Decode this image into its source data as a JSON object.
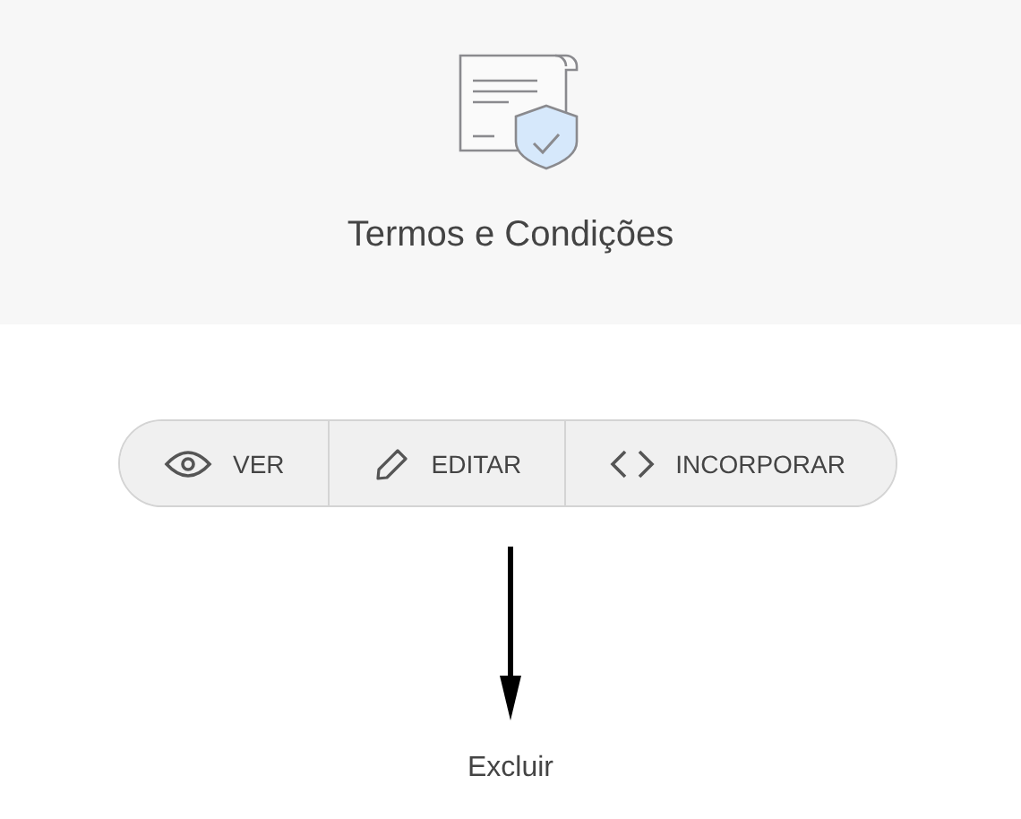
{
  "header": {
    "title": "Termos e Condições"
  },
  "actions": [
    {
      "kind": "view",
      "label": "VER"
    },
    {
      "kind": "edit",
      "label": "EDITAR"
    },
    {
      "kind": "embed",
      "label": "INCORPORAR"
    }
  ],
  "delete_link": "Excluir"
}
